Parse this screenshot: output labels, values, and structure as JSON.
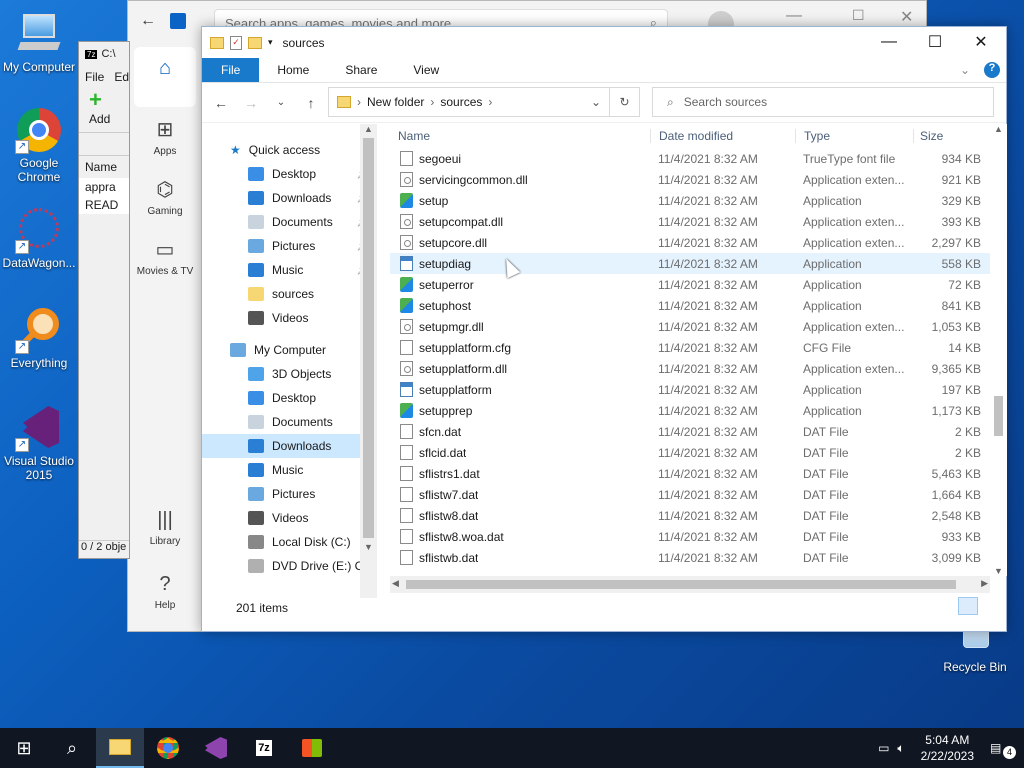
{
  "desktop": {
    "icons": [
      {
        "label": "My Computer"
      },
      {
        "label": "Google Chrome"
      },
      {
        "label": "DataWagon..."
      },
      {
        "label": "Everything"
      },
      {
        "label": "Visual Studio 2015"
      },
      {
        "label": "Recycle Bin"
      }
    ]
  },
  "store": {
    "search_placeholder": "Search apps, games, movies and more",
    "nav": [
      {
        "label": "Apps"
      },
      {
        "label": "Gaming"
      },
      {
        "label": "Movies & TV"
      },
      {
        "label": "Library"
      },
      {
        "label": "Help"
      }
    ]
  },
  "zip": {
    "title": "C:\\",
    "menu_file": "File",
    "menu_edit": "Ed",
    "add": "Add",
    "col_name": "Name",
    "item1": "appra",
    "item2": "READ",
    "status": "0 / 2 obje"
  },
  "explorer": {
    "title": "sources",
    "ribbon": {
      "file": "File",
      "home": "Home",
      "share": "Share",
      "view": "View"
    },
    "breadcrumb": [
      "New folder",
      "sources"
    ],
    "search_placeholder": "Search sources",
    "nav": {
      "quick_access": "Quick access",
      "qa_items": [
        {
          "label": "Desktop",
          "color": "#3a8ee6"
        },
        {
          "label": "Downloads",
          "color": "#2a7fd4"
        },
        {
          "label": "Documents",
          "color": "#c9d3dd"
        },
        {
          "label": "Pictures",
          "color": "#6aa9e0"
        },
        {
          "label": "Music",
          "color": "#2a7fd4"
        },
        {
          "label": "sources",
          "color": "#f7d774"
        },
        {
          "label": "Videos",
          "color": "#555"
        }
      ],
      "my_computer": "My Computer",
      "mc_items": [
        {
          "label": "3D Objects",
          "color": "#4fa3e8"
        },
        {
          "label": "Desktop",
          "color": "#3a8ee6"
        },
        {
          "label": "Documents",
          "color": "#c9d3dd"
        },
        {
          "label": "Downloads",
          "color": "#2a7fd4"
        },
        {
          "label": "Music",
          "color": "#2a7fd4"
        },
        {
          "label": "Pictures",
          "color": "#6aa9e0"
        },
        {
          "label": "Videos",
          "color": "#555"
        },
        {
          "label": "Local Disk (C:)",
          "color": "#888"
        },
        {
          "label": "DVD Drive (E:) C(",
          "color": "#b0b0b0"
        }
      ]
    },
    "columns": {
      "name": "Name",
      "date": "Date modified",
      "type": "Type",
      "size": "Size"
    },
    "files": [
      {
        "name": "segoeui",
        "date": "11/4/2021 8:32 AM",
        "type": "TrueType font file",
        "size": "934 KB",
        "icon": "doc"
      },
      {
        "name": "servicingcommon.dll",
        "date": "11/4/2021 8:32 AM",
        "type": "Application exten...",
        "size": "921 KB",
        "icon": "gear"
      },
      {
        "name": "setup",
        "date": "11/4/2021 8:32 AM",
        "type": "Application",
        "size": "329 KB",
        "icon": "setup"
      },
      {
        "name": "setupcompat.dll",
        "date": "11/4/2021 8:32 AM",
        "type": "Application exten...",
        "size": "393 KB",
        "icon": "gear"
      },
      {
        "name": "setupcore.dll",
        "date": "11/4/2021 8:32 AM",
        "type": "Application exten...",
        "size": "2,297 KB",
        "icon": "gear"
      },
      {
        "name": "setupdiag",
        "date": "11/4/2021 8:32 AM",
        "type": "Application",
        "size": "558 KB",
        "icon": "app"
      },
      {
        "name": "setuperror",
        "date": "11/4/2021 8:32 AM",
        "type": "Application",
        "size": "72 KB",
        "icon": "setup"
      },
      {
        "name": "setuphost",
        "date": "11/4/2021 8:32 AM",
        "type": "Application",
        "size": "841 KB",
        "icon": "setup"
      },
      {
        "name": "setupmgr.dll",
        "date": "11/4/2021 8:32 AM",
        "type": "Application exten...",
        "size": "1,053 KB",
        "icon": "gear"
      },
      {
        "name": "setupplatform.cfg",
        "date": "11/4/2021 8:32 AM",
        "type": "CFG File",
        "size": "14 KB",
        "icon": "doc"
      },
      {
        "name": "setupplatform.dll",
        "date": "11/4/2021 8:32 AM",
        "type": "Application exten...",
        "size": "9,365 KB",
        "icon": "gear"
      },
      {
        "name": "setupplatform",
        "date": "11/4/2021 8:32 AM",
        "type": "Application",
        "size": "197 KB",
        "icon": "app"
      },
      {
        "name": "setupprep",
        "date": "11/4/2021 8:32 AM",
        "type": "Application",
        "size": "1,173 KB",
        "icon": "setup"
      },
      {
        "name": "sfcn.dat",
        "date": "11/4/2021 8:32 AM",
        "type": "DAT File",
        "size": "2 KB",
        "icon": "doc"
      },
      {
        "name": "sflcid.dat",
        "date": "11/4/2021 8:32 AM",
        "type": "DAT File",
        "size": "2 KB",
        "icon": "doc"
      },
      {
        "name": "sflistrs1.dat",
        "date": "11/4/2021 8:32 AM",
        "type": "DAT File",
        "size": "5,463 KB",
        "icon": "doc"
      },
      {
        "name": "sflistw7.dat",
        "date": "11/4/2021 8:32 AM",
        "type": "DAT File",
        "size": "1,664 KB",
        "icon": "doc"
      },
      {
        "name": "sflistw8.dat",
        "date": "11/4/2021 8:32 AM",
        "type": "DAT File",
        "size": "2,548 KB",
        "icon": "doc"
      },
      {
        "name": "sflistw8.woa.dat",
        "date": "11/4/2021 8:32 AM",
        "type": "DAT File",
        "size": "933 KB",
        "icon": "doc"
      },
      {
        "name": "sflistwb.dat",
        "date": "11/4/2021 8:32 AM",
        "type": "DAT File",
        "size": "3,099 KB",
        "icon": "doc"
      }
    ],
    "hovered_row": 5,
    "status": "201 items"
  },
  "taskbar": {
    "time": "5:04 AM",
    "date": "2/22/2023",
    "notif_count": "4"
  }
}
